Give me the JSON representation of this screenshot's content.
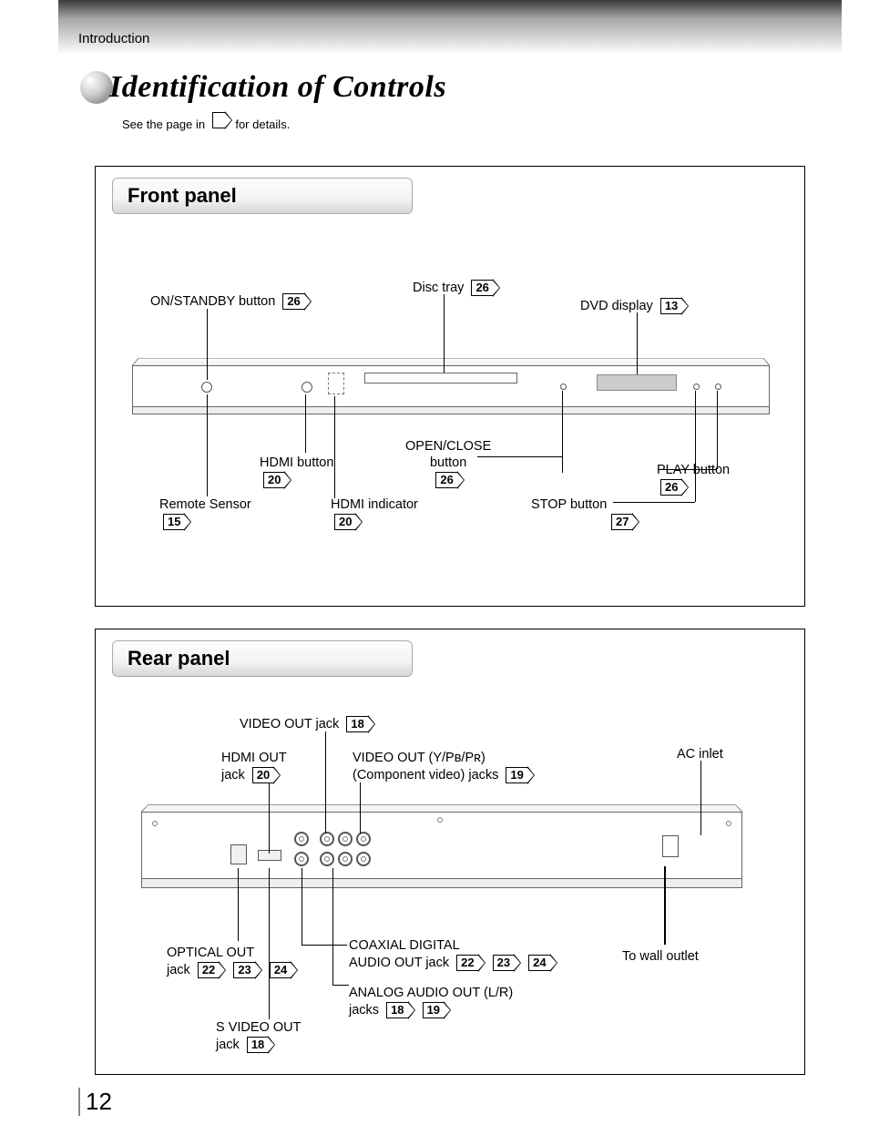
{
  "header": {
    "section": "Introduction",
    "title": "Identification of Controls",
    "subtitle_before": "See the page in ",
    "subtitle_after": " for details."
  },
  "front_panel": {
    "heading": "Front panel",
    "labels": {
      "on_standby": "ON/STANDBY button",
      "on_standby_ref": "26",
      "disc_tray": "Disc tray",
      "disc_tray_ref": "26",
      "dvd_display": "DVD display",
      "dvd_display_ref": "13",
      "hdmi_button": "HDMI button",
      "hdmi_button_ref": "20",
      "open_close_l1": "OPEN/CLOSE",
      "open_close_l2": "button",
      "open_close_ref": "26",
      "play_button": "PLAY button",
      "play_button_ref": "26",
      "remote_sensor": "Remote Sensor",
      "remote_sensor_ref": "15",
      "hdmi_indicator": "HDMI indicator",
      "hdmi_indicator_ref": "20",
      "stop_button": "STOP button",
      "stop_button_ref": "27"
    }
  },
  "rear_panel": {
    "heading": "Rear panel",
    "labels": {
      "video_out": "VIDEO OUT jack",
      "video_out_ref": "18",
      "hdmi_out_l1": "HDMI OUT",
      "hdmi_out_l2": "jack",
      "hdmi_out_ref": "20",
      "component_l1": "VIDEO OUT (Y/Pʙ/Pʀ)",
      "component_l2": "(Component video) jacks",
      "component_ref": "19",
      "ac_inlet": "AC inlet",
      "optical_l1": "OPTICAL OUT",
      "optical_l2": "jack",
      "optical_ref1": "22",
      "optical_ref2": "23",
      "optical_ref3": "24",
      "coax_l1": "COAXIAL DIGITAL",
      "coax_l2": "AUDIO OUT jack",
      "coax_ref1": "22",
      "coax_ref2": "23",
      "coax_ref3": "24",
      "to_wall": "To wall outlet",
      "analog_l1": "ANALOG AUDIO OUT (L/R)",
      "analog_l2": "jacks",
      "analog_ref1": "18",
      "analog_ref2": "19",
      "svideo_l1": "S VIDEO OUT",
      "svideo_l2": "jack",
      "svideo_ref": "18"
    }
  },
  "page_number": "12"
}
